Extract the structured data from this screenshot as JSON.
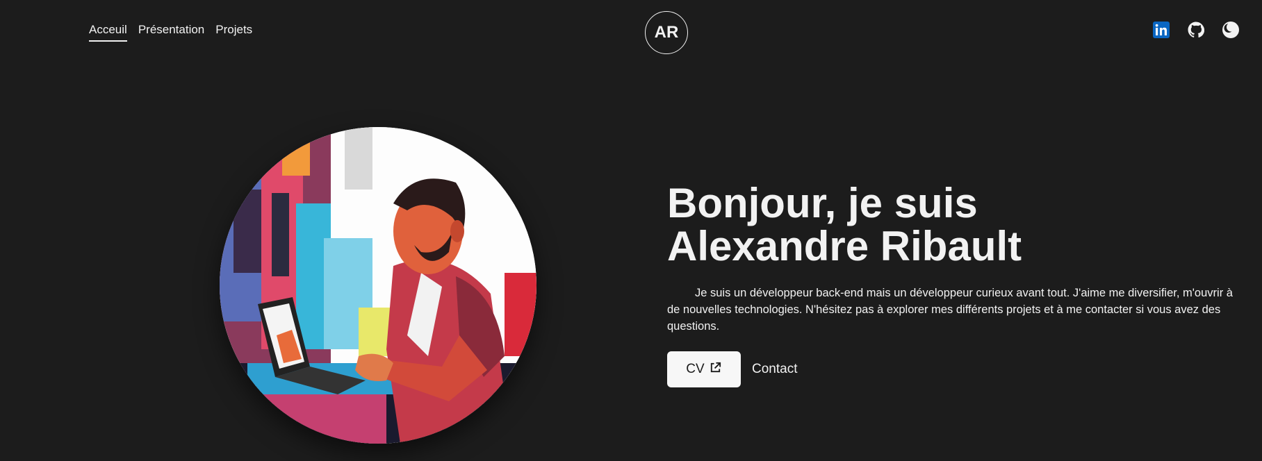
{
  "nav": {
    "items": [
      {
        "label": "Acceuil",
        "active": true
      },
      {
        "label": "Présentation",
        "active": false
      },
      {
        "label": "Projets",
        "active": false
      }
    ]
  },
  "logo": {
    "initials": "AR"
  },
  "socials": {
    "items": [
      {
        "icon": "linkedin-icon",
        "color": "#0a66c2"
      },
      {
        "icon": "github-icon",
        "color": "#f2f2f2"
      },
      {
        "icon": "moon-icon",
        "color": "#f2f2f2"
      }
    ]
  },
  "hero": {
    "title_line1": "Bonjour, je suis",
    "title_line2": "Alexandre Ribault",
    "description": "Je suis un développeur back-end mais un développeur curieux avant tout. J'aime me diversifier, m'ouvrir à de nouvelles technologies. N'hésitez pas à explorer mes différents projets et à me contacter si vous avez des questions.",
    "cv_label": "CV",
    "contact_label": "Contact"
  },
  "theme": {
    "background": "#1c1c1c",
    "text": "#f2f2f2",
    "button_bg": "#f7f7f7"
  }
}
